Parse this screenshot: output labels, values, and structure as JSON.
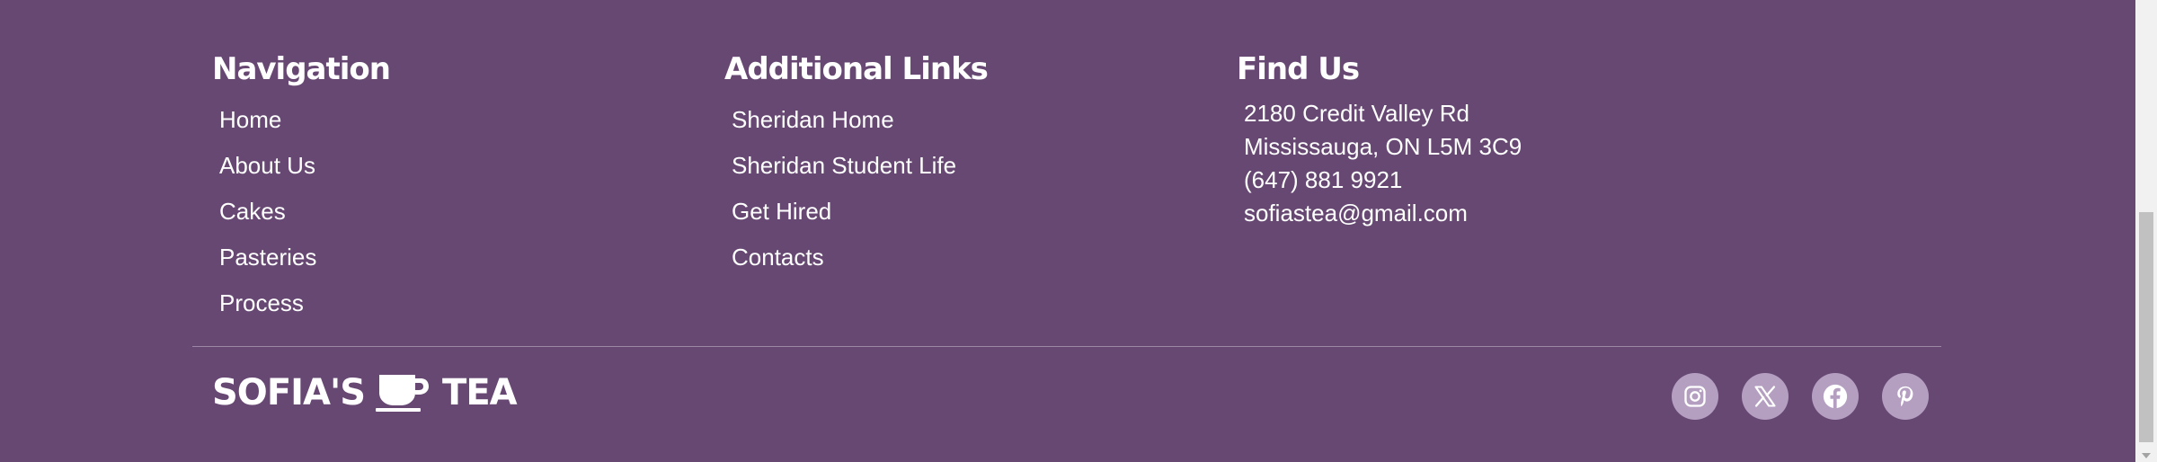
{
  "navigation": {
    "heading": "Navigation",
    "links": [
      "Home",
      "About Us",
      "Cakes",
      "Pasteries",
      "Process"
    ]
  },
  "additional": {
    "heading": "Additional Links",
    "links": [
      "Sheridan Home",
      "Sheridan Student Life",
      "Get Hired",
      "Contacts"
    ]
  },
  "find_us": {
    "heading": "Find Us",
    "address_line1": "2180 Credit Valley Rd",
    "address_line2": "Mississauga, ON L5M 3C9",
    "phone": "(647) 881 9921",
    "email": "sofiastea@gmail.com"
  },
  "brand": {
    "left": "SOFIA'S",
    "right": "TEA",
    "icon": "tea-cup-icon"
  },
  "socials": [
    "instagram-icon",
    "x-twitter-icon",
    "facebook-icon",
    "pinterest-icon"
  ],
  "colors": {
    "background": "#674873",
    "social_bg": "#b59fc1",
    "text": "#ffffff"
  }
}
